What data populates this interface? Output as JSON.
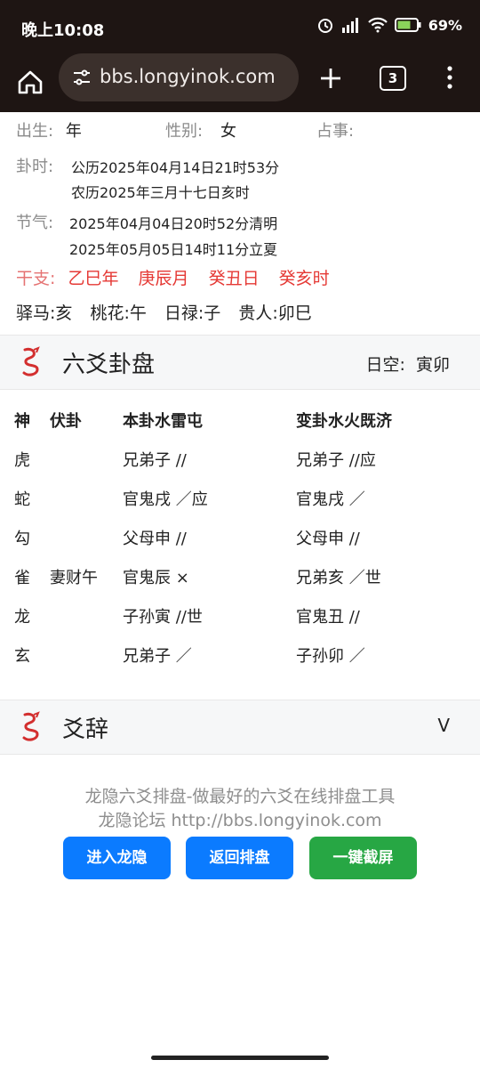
{
  "status": {
    "time": "晚上10:08",
    "battery": "69%"
  },
  "browser": {
    "url": "bbs.longyinok.com",
    "tab_count": "3"
  },
  "info": {
    "birth_label": "出生:",
    "birth_value": "年",
    "gender_label": "性别:",
    "gender_value": "女",
    "divination_label": "占事:",
    "time_label": "卦时:",
    "time_solar": "公历2025年04月14日21时53分",
    "time_lunar": "农历2025年三月十七日亥时",
    "solar_term_label": "节气:",
    "solar_term_1": "2025年04月04日20时52分清明",
    "solar_term_2": "2025年05月05日14时11分立夏",
    "ganzhi_label": "干支:",
    "ganzhi": [
      "乙巳年",
      "庚辰月",
      "癸丑日",
      "癸亥时"
    ],
    "shensha": [
      "驿马:亥",
      "桃花:午",
      "日禄:子",
      "贵人:卯巳"
    ]
  },
  "panel": {
    "title": "六爻卦盘",
    "kong_label": "日空:",
    "kong_value": "寅卯"
  },
  "gua": {
    "headers": [
      "神",
      "伏卦",
      "本卦水雷屯",
      "变卦水火既济"
    ],
    "rows": [
      [
        "虎",
        "",
        "兄弟子 //",
        "兄弟子 //应"
      ],
      [
        "蛇",
        "",
        "官鬼戌 ／应",
        "官鬼戌 ／"
      ],
      [
        "勾",
        "",
        "父母申 //",
        "父母申 //"
      ],
      [
        "雀",
        "妻财午",
        "官鬼辰 ×",
        "兄弟亥 ／世"
      ],
      [
        "龙",
        "",
        "子孙寅 //世",
        "官鬼丑 //"
      ],
      [
        "玄",
        "",
        "兄弟子 ／",
        "子孙卯 ／"
      ]
    ]
  },
  "yaoci": {
    "title": "爻辞",
    "toggle": "V"
  },
  "footer": {
    "line1": "龙隐六爻排盘-做最好的六爻在线排盘工具",
    "line2": "龙隐论坛 http://bbs.longyinok.com",
    "buttons": [
      "进入龙隐",
      "返回排盘",
      "一键截屏"
    ]
  },
  "colors": {
    "accent_red": "#e53935",
    "button_blue": "#0b7bff",
    "button_green": "#27a744",
    "browser_bar": "#1e1513"
  }
}
